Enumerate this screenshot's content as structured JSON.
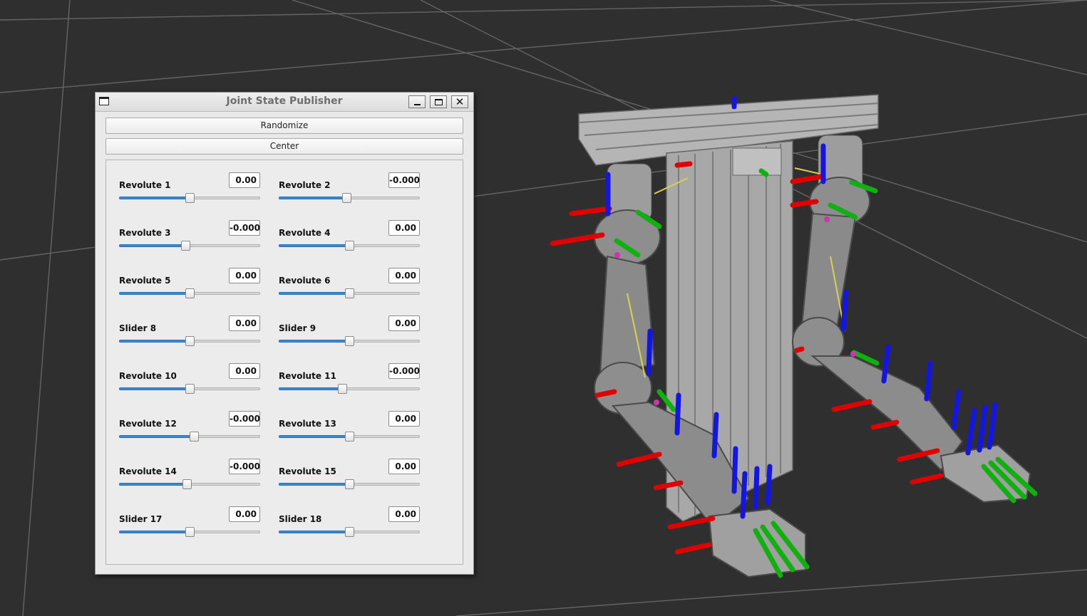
{
  "window": {
    "title": "Joint State Publisher",
    "buttons": {
      "randomize": "Randomize",
      "center": "Center"
    }
  },
  "joints": [
    {
      "label": "Revolute 1",
      "value": "0.00",
      "position": 0.5
    },
    {
      "label": "Revolute 2",
      "value": "-0.000",
      "position": 0.48
    },
    {
      "label": "Revolute 3",
      "value": "-0.000",
      "position": 0.47
    },
    {
      "label": "Revolute 4",
      "value": "0.00",
      "position": 0.5
    },
    {
      "label": "Revolute 5",
      "value": "0.00",
      "position": 0.5
    },
    {
      "label": "Revolute 6",
      "value": "0.00",
      "position": 0.5
    },
    {
      "label": "Slider 8",
      "value": "0.00",
      "position": 0.5
    },
    {
      "label": "Slider 9",
      "value": "0.00",
      "position": 0.5
    },
    {
      "label": "Revolute 10",
      "value": "0.00",
      "position": 0.5
    },
    {
      "label": "Revolute 11",
      "value": "-0.000",
      "position": 0.45
    },
    {
      "label": "Revolute 12",
      "value": "-0.000",
      "position": 0.53
    },
    {
      "label": "Revolute 13",
      "value": "0.00",
      "position": 0.5
    },
    {
      "label": "Revolute 14",
      "value": "-0.000",
      "position": 0.48
    },
    {
      "label": "Revolute 15",
      "value": "0.00",
      "position": 0.5
    },
    {
      "label": "Slider 17",
      "value": "0.00",
      "position": 0.5
    },
    {
      "label": "Slider 18",
      "value": "0.00",
      "position": 0.5
    }
  ],
  "colors": {
    "background": "#2f2f2f",
    "grid": "#6a6a6a",
    "slider_fill": "#3a8ad6",
    "axis_x": "#e00000",
    "axis_y": "#11b011",
    "axis_z": "#1515e0",
    "robot_metal": "#9a9a9a"
  },
  "icons": {
    "window": "window-icon",
    "minimize": "minimize-icon",
    "maximize": "maximize-icon",
    "close": "close-icon"
  }
}
